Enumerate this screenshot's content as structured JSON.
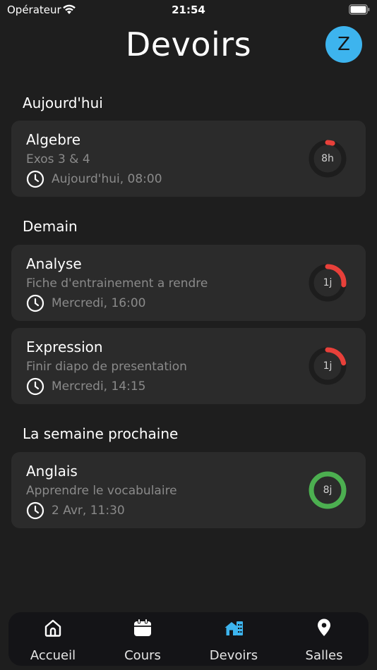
{
  "status_bar": {
    "carrier": "Opérateur",
    "time": "21:54"
  },
  "header": {
    "title": "Devoirs",
    "avatar_initial": "Z"
  },
  "sections": [
    {
      "title": "Aujourd'hui"
    },
    {
      "title": "Demain"
    },
    {
      "title": "La semaine prochaine"
    }
  ],
  "cards": [
    {
      "title": "Algebre",
      "desc": "Exos 3 & 4",
      "due": "Aujourd'hui, 08:00",
      "remaining": "8h",
      "progress": 0.05,
      "color": "#e8403a"
    },
    {
      "title": "Analyse",
      "desc": "Fiche d'entrainement a rendre",
      "due": "Mercredi, 16:00",
      "remaining": "1j",
      "progress": 0.27,
      "color": "#e8403a"
    },
    {
      "title": "Expression",
      "desc": "Finir diapo de presentation",
      "due": "Mercredi, 14:15",
      "remaining": "1j",
      "progress": 0.22,
      "color": "#e8403a"
    },
    {
      "title": "Anglais",
      "desc": "Apprendre le vocabulaire",
      "due": "2 Avr, 11:30",
      "remaining": "8j",
      "progress": 1.0,
      "color": "#4caf50"
    }
  ],
  "tabs": [
    {
      "label": "Accueil",
      "icon": "home-icon"
    },
    {
      "label": "Cours",
      "icon": "calendar-icon"
    },
    {
      "label": "Devoirs",
      "icon": "homework-house-icon",
      "active": true
    },
    {
      "label": "Salles",
      "icon": "location-pin-icon"
    }
  ],
  "colors": {
    "accent": "#3db4ee",
    "background": "#1e1e1e",
    "card": "#2b2b2b"
  }
}
